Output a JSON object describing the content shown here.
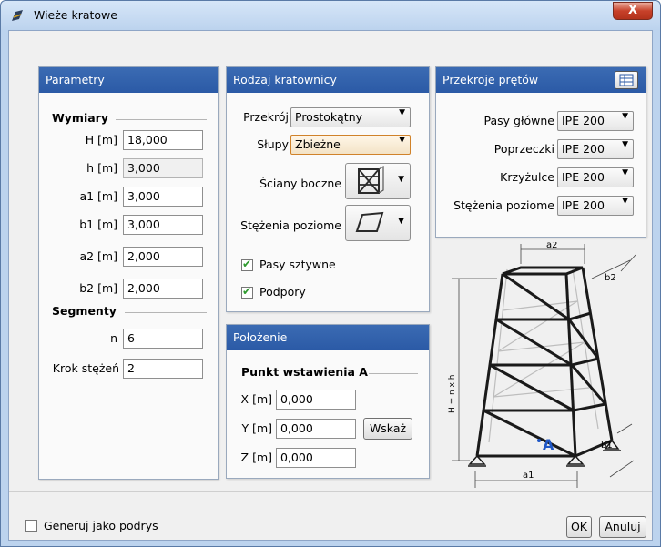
{
  "window": {
    "title": "Wieże kratowe",
    "close_label": "X"
  },
  "parametry": {
    "header": "Parametry",
    "wymiary_label": "Wymiary",
    "fields": [
      {
        "label": "H [m]",
        "value": "18,000",
        "readonly": false
      },
      {
        "label": "h [m]",
        "value": "3,000",
        "readonly": true
      },
      {
        "label": "a1 [m]",
        "value": "3,000",
        "readonly": false
      },
      {
        "label": "b1 [m]",
        "value": "3,000",
        "readonly": false
      },
      {
        "label": "a2 [m]",
        "value": "2,000",
        "readonly": false
      },
      {
        "label": "b2 [m]",
        "value": "2,000",
        "readonly": false
      }
    ],
    "segmenty_label": "Segmenty",
    "n_label": "n",
    "n_value": "6",
    "krok_label": "Krok stężeń",
    "krok_value": "2"
  },
  "rodzaj": {
    "header": "Rodzaj kratownicy",
    "przekroj_label": "Przekrój",
    "przekroj_value": "Prostokątny",
    "slupy_label": "Słupy",
    "slupy_value": "Zbieżne",
    "sciany_label": "Ściany boczne",
    "stezenia_label": "Stężenia poziome",
    "pasy_label": "Pasy sztywne",
    "pasy_checked": true,
    "podpory_label": "Podpory",
    "podpory_checked": true
  },
  "polozenie": {
    "header": "Położenie",
    "punkt_label": "Punkt wstawienia A",
    "x_label": "X [m]",
    "x_value": "0,000",
    "y_label": "Y [m]",
    "y_value": "0,000",
    "z_label": "Z [m]",
    "z_value": "0,000",
    "wskaz_label": "Wskaż"
  },
  "przekroje": {
    "header": "Przekroje prętów",
    "rows": [
      {
        "label": "Pasy główne",
        "value": "IPE 200"
      },
      {
        "label": "Poprzeczki",
        "value": "IPE 200"
      },
      {
        "label": "Krzyżulce",
        "value": "IPE 200"
      },
      {
        "label": "Stężenia poziome",
        "value": "IPE 200"
      }
    ]
  },
  "diagram": {
    "a2": "a2",
    "b2": "b2",
    "height": "H = n x h",
    "a1": "a1",
    "b1": "b1",
    "point": "A"
  },
  "footer": {
    "generuj_label": "Generuj jako podrys",
    "generuj_checked": false,
    "ok_label": "OK",
    "cancel_label": "Anuluj"
  },
  "colors": {
    "panel_header": "#2b5aa6",
    "window_frame": "#bcd3ee",
    "checkmark": "#2e9a2e",
    "point_a": "#1f57c6"
  }
}
